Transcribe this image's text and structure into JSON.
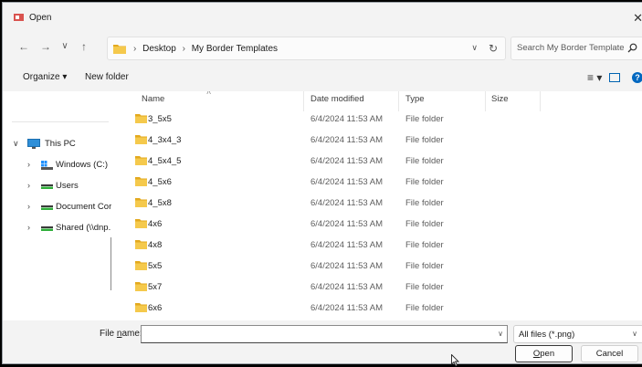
{
  "window": {
    "title": "Open",
    "close_glyph": "✕"
  },
  "nav": {
    "back_glyph": "←",
    "forward_glyph": "→",
    "recent_glyph": "∨",
    "up_glyph": "↑"
  },
  "address": {
    "crumbs": [
      "Desktop",
      "My Border Templates"
    ],
    "separator": "›",
    "dropdown_glyph": "∨",
    "refresh_glyph": "↻"
  },
  "search": {
    "placeholder": "Search My Border Templates"
  },
  "toolbar": {
    "organize_label": "Organize ▾",
    "new_folder_label": "New folder",
    "view_glyph": "≡ ▾",
    "help_glyph": "?"
  },
  "sidebar": {
    "items": [
      {
        "label": "This PC",
        "expanded": true,
        "icon": "monitor-icon"
      },
      {
        "label": "Windows (C:)",
        "expanded": false,
        "icon": "drive-icon"
      },
      {
        "label": "Users",
        "expanded": false,
        "icon": "network-drive-icon"
      },
      {
        "label": "Document Cor",
        "expanded": false,
        "icon": "network-drive-icon"
      },
      {
        "label": "Shared (\\\\dnp.",
        "expanded": false,
        "icon": "network-drive-icon"
      }
    ],
    "chev_collapsed": "›",
    "chev_expanded": "∨"
  },
  "columns": {
    "name": "Name",
    "date": "Date modified",
    "type": "Type",
    "size": "Size",
    "sort_glyph": "˄"
  },
  "files": [
    {
      "name": "3_5x5",
      "date": "6/4/2024 11:53 AM",
      "type": "File folder"
    },
    {
      "name": "4_3x4_3",
      "date": "6/4/2024 11:53 AM",
      "type": "File folder"
    },
    {
      "name": "4_5x4_5",
      "date": "6/4/2024 11:53 AM",
      "type": "File folder"
    },
    {
      "name": "4_5x6",
      "date": "6/4/2024 11:53 AM",
      "type": "File folder"
    },
    {
      "name": "4_5x8",
      "date": "6/4/2024 11:53 AM",
      "type": "File folder"
    },
    {
      "name": "4x6",
      "date": "6/4/2024 11:53 AM",
      "type": "File folder"
    },
    {
      "name": "4x8",
      "date": "6/4/2024 11:53 AM",
      "type": "File folder"
    },
    {
      "name": "5x5",
      "date": "6/4/2024 11:53 AM",
      "type": "File folder"
    },
    {
      "name": "5x7",
      "date": "6/4/2024 11:53 AM",
      "type": "File folder"
    },
    {
      "name": "6x6",
      "date": "6/4/2024 11:53 AM",
      "type": "File folder"
    }
  ],
  "footer": {
    "file_name_prefix": "File ",
    "file_name_accel": "n",
    "file_name_suffix": "ame:",
    "file_name_value": "",
    "filter_label": "All files (*.png)",
    "dropdown_glyph": "∨",
    "open_accel": "O",
    "open_rest": "pen",
    "cancel_label": "Cancel"
  },
  "colors": {
    "folder": "#f5c94c",
    "folder_dark": "#e3a91e",
    "accent": "#0067c0",
    "chrome": "#f3f3f3"
  }
}
